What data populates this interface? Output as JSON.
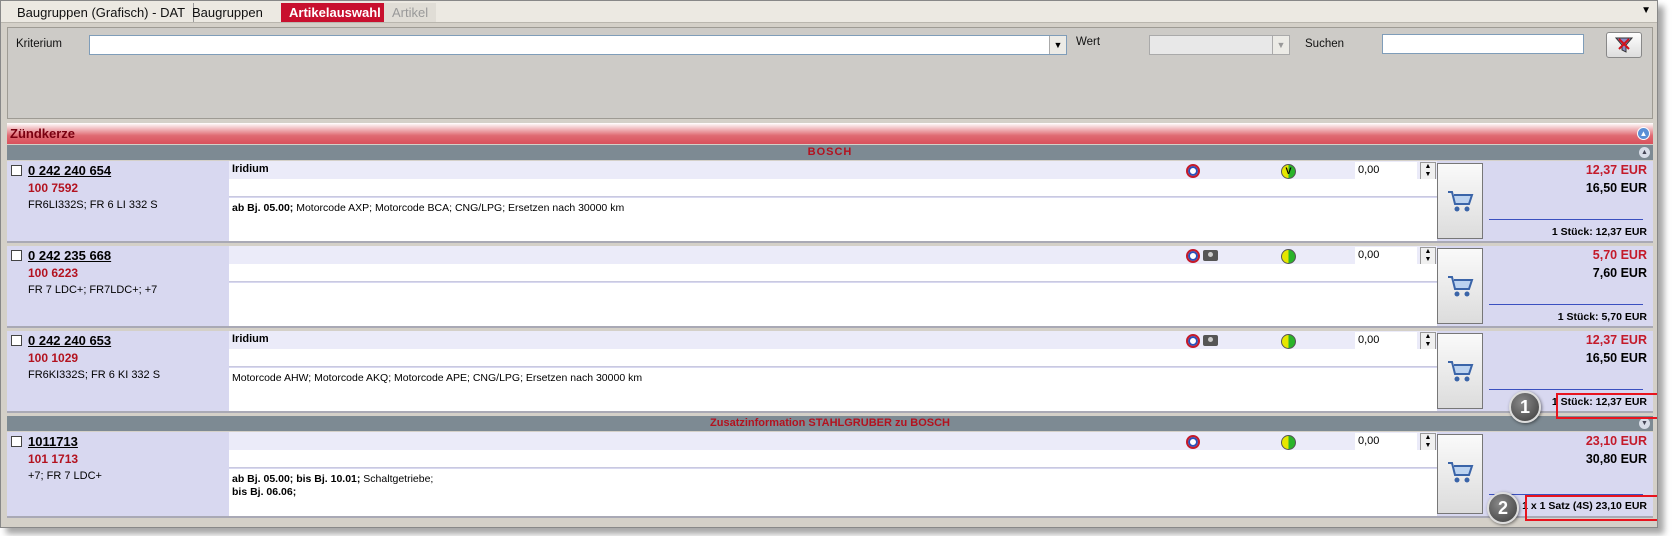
{
  "tabs": [
    {
      "label": "Baugruppen (Grafisch)  - DAT",
      "state": "normal"
    },
    {
      "label": "Baugruppen",
      "state": "normal"
    },
    {
      "label": "Artikelauswahl",
      "state": "active"
    },
    {
      "label": "Artikel",
      "state": "disabled"
    }
  ],
  "filter": {
    "kriterium_label": "Kriterium",
    "kriterium_value": "",
    "wert_label": "Wert",
    "wert_value": "",
    "suchen_label": "Suchen",
    "suchen_value": ""
  },
  "group": {
    "title": "Zündkerze"
  },
  "brands": {
    "bosch": "BOSCH",
    "zusatz": "Zusatzinformation STAHLGRUBER zu  BOSCH"
  },
  "articles": [
    {
      "article_no": "0 242 240 654",
      "internal_no": "100 7592",
      "refs": "FR6LI332S; FR 6 LI 332 S",
      "feature": "Iridium",
      "desc_bold": "ab Bj. 05.00;",
      "desc_text": " Motorcode AXP; Motorcode BCA; CNG/LPG; Ersetzen nach 30000 km",
      "desc_line2_bold": "",
      "avail_label": "V",
      "qty": "0,00",
      "price_net": "12,37 EUR",
      "price_gross": "16,50 EUR",
      "unit_price": "1 Stück: 12,37 EUR"
    },
    {
      "article_no": "0 242 235 668",
      "internal_no": "100 6223",
      "refs": "FR 7 LDC+; FR7LDC+; +7",
      "feature": "",
      "desc_bold": "",
      "desc_text": "",
      "desc_line2_bold": "",
      "avail_label": "",
      "qty": "0,00",
      "price_net": "5,70 EUR",
      "price_gross": "7,60 EUR",
      "unit_price": "1 Stück: 5,70 EUR"
    },
    {
      "article_no": "0 242 240 653",
      "internal_no": "100 1029",
      "refs": "FR6KI332S; FR 6 KI 332 S",
      "feature": "Iridium",
      "desc_bold": "",
      "desc_text": "Motorcode AHW; Motorcode AKQ; Motorcode APE; CNG/LPG; Ersetzen nach 30000 km",
      "desc_line2_bold": "",
      "avail_label": "",
      "qty": "0,00",
      "price_net": "12,37 EUR",
      "price_gross": "16,50 EUR",
      "unit_price": "1 Stück: 12,37 EUR"
    },
    {
      "article_no": "1011713",
      "internal_no": "101 1713",
      "refs": "+7; FR 7 LDC+",
      "feature": "",
      "desc_bold": "ab Bj. 05.00; bis Bj. 10.01;",
      "desc_text": " Schaltgetriebe;",
      "desc_line2_bold": "bis Bj. 06.06;",
      "avail_label": "",
      "qty": "0,00",
      "price_net": "23,10 EUR",
      "price_gross": "30,80 EUR",
      "unit_price": "1 x 1 Satz (4S) 23,10 EUR"
    }
  ],
  "callouts": [
    "1",
    "2"
  ],
  "colors": {
    "accent": "#c8102e",
    "price_red": "#c41a2a",
    "highlight": "#e8141e"
  },
  "icons": {
    "delivery": "clock-icon",
    "photo": "camera-icon",
    "availability": "availability-dot-icon",
    "cart": "cart-icon",
    "filter": "filter-icon"
  }
}
